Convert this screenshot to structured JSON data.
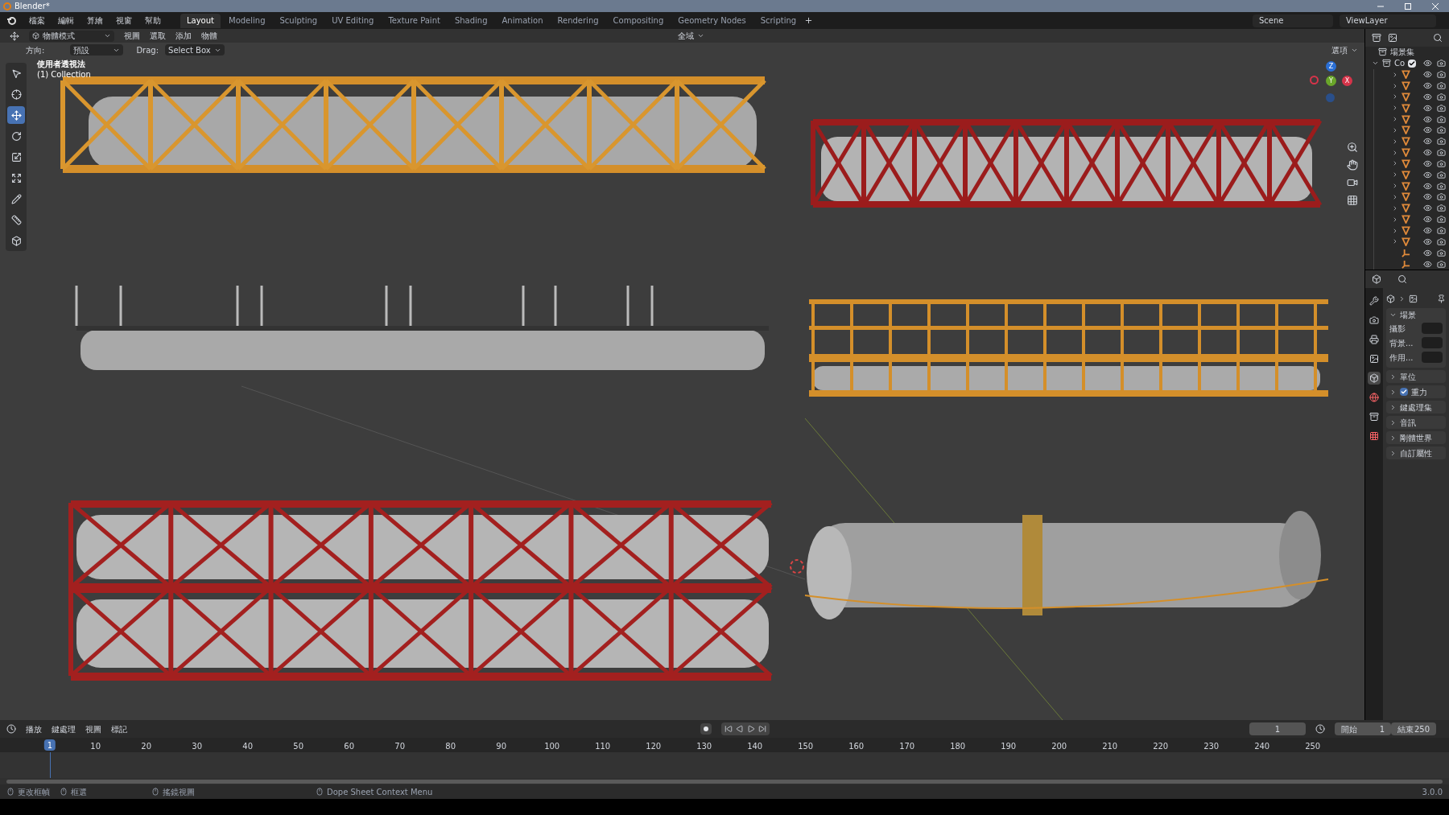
{
  "window": {
    "title": "Blender*"
  },
  "menu": [
    "檔案",
    "編輯",
    "算繪",
    "視窗",
    "幫助"
  ],
  "workspaces": [
    {
      "label": "Layout",
      "selected": true
    },
    {
      "label": "Modeling",
      "selected": false
    },
    {
      "label": "Sculpting",
      "selected": false
    },
    {
      "label": "UV Editing",
      "selected": false
    },
    {
      "label": "Texture Paint",
      "selected": false
    },
    {
      "label": "Shading",
      "selected": false
    },
    {
      "label": "Animation",
      "selected": false
    },
    {
      "label": "Rendering",
      "selected": false
    },
    {
      "label": "Compositing",
      "selected": false
    },
    {
      "label": "Geometry Nodes",
      "selected": false
    },
    {
      "label": "Scripting",
      "selected": false
    }
  ],
  "scene": {
    "name": "Scene"
  },
  "view_layer": {
    "name": "ViewLayer"
  },
  "viewport_header": {
    "mode": "物體模式",
    "menus": [
      "視圖",
      "選取",
      "添加",
      "物體"
    ],
    "transform": "全域"
  },
  "tool_settings": {
    "orientation_label": "方向:",
    "orientation": "預設",
    "drag_label": "Drag:",
    "drag": "Select Box",
    "options": "選項"
  },
  "viewport": {
    "view_name": "使用者透視法",
    "collection": "(1) Collection",
    "tools": [
      {
        "kind": "select",
        "selected": false
      },
      {
        "kind": "cursor",
        "selected": false
      },
      {
        "kind": "move",
        "selected": true
      },
      {
        "kind": "rotate",
        "selected": false
      },
      {
        "kind": "scale",
        "selected": false
      },
      {
        "kind": "transform",
        "selected": false
      },
      {
        "kind": "annotate",
        "selected": false
      },
      {
        "kind": "measure",
        "selected": false
      },
      {
        "kind": "add",
        "selected": false
      }
    ],
    "gizmo": {
      "z": "Z",
      "y": "Y",
      "x": "X"
    }
  },
  "outliner": {
    "root": "場景集",
    "collection": {
      "name": "Co",
      "checked": true,
      "expanded": true,
      "children": [
        {
          "kind": "mesh"
        },
        {
          "kind": "mesh"
        },
        {
          "kind": "mesh"
        },
        {
          "kind": "mesh"
        },
        {
          "kind": "mesh"
        },
        {
          "kind": "mesh"
        },
        {
          "kind": "mesh"
        },
        {
          "kind": "mesh"
        },
        {
          "kind": "mesh"
        },
        {
          "kind": "mesh"
        },
        {
          "kind": "mesh"
        },
        {
          "kind": "mesh"
        },
        {
          "kind": "mesh"
        },
        {
          "kind": "mesh"
        },
        {
          "kind": "mesh"
        },
        {
          "kind": "mesh"
        },
        {
          "kind": "empty"
        },
        {
          "kind": "empty"
        }
      ]
    }
  },
  "properties": {
    "tabs": [
      {
        "kind": "tool",
        "selected": false
      },
      {
        "kind": "render",
        "selected": false
      },
      {
        "kind": "output",
        "selected": false
      },
      {
        "kind": "view_layer",
        "selected": false
      },
      {
        "kind": "scene",
        "selected": true
      },
      {
        "kind": "world",
        "selected": false
      },
      {
        "kind": "collection",
        "selected": false
      },
      {
        "kind": "texture",
        "selected": false
      }
    ],
    "panel": {
      "title": "場景",
      "expanded": true,
      "fields": [
        {
          "label": "攝影"
        },
        {
          "label": "背景..."
        },
        {
          "label": "作用..."
        }
      ]
    },
    "sections": [
      {
        "title": "單位",
        "kind": "plain"
      },
      {
        "title": "重力",
        "kind": "checkbox",
        "checked": true
      },
      {
        "title": "鍵處理集",
        "kind": "plain"
      },
      {
        "title": "音訊",
        "kind": "plain"
      },
      {
        "title": "剛體世界",
        "kind": "plain"
      },
      {
        "title": "自訂屬性",
        "kind": "plain"
      }
    ]
  },
  "timeline": {
    "menus": [
      "播放",
      "鍵處理",
      "視圖",
      "標記"
    ],
    "current_frame": "1",
    "start_label": "開始",
    "start": "1",
    "end_label": "結束",
    "end": "250",
    "ticks": [
      "1",
      "10",
      "20",
      "30",
      "40",
      "50",
      "60",
      "70",
      "80",
      "90",
      "100",
      "110",
      "120",
      "130",
      "140",
      "150",
      "160",
      "170",
      "180",
      "190",
      "200",
      "210",
      "220",
      "230",
      "240",
      "250"
    ]
  },
  "status_bar": {
    "hints": [
      "更改框幀",
      "框選",
      "搖鏡視圖",
      "Dope Sheet Context Menu"
    ],
    "version": "3.0.0"
  }
}
